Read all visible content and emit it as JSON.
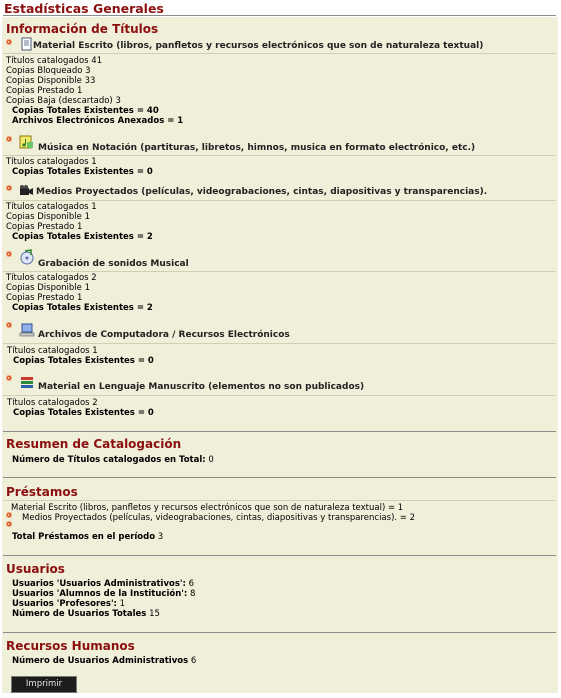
{
  "page_title": "Estadísticas Generales",
  "info_titulos": {
    "heading": "Información de Títulos",
    "categories": [
      {
        "title": "Material Escrito (libros, panfletos y recursos electrónicos que son de naturaleza textual)",
        "icon": "book-document-icon",
        "lines": [
          "Títulos catalogados 41",
          "Copias Bloqueado 3",
          "Copias Disponible 33",
          "Copias Prestado 1",
          "Copias Baja (descartado) 3"
        ],
        "totals": [
          "Copias Totales Existentes = 40",
          "Archivos Electrónicos Anexados = 1"
        ]
      },
      {
        "title": "Música en Notación (partituras, libretos, himnos, musica en formato electrónico, etc.)",
        "icon": "sheet-music-icon",
        "lines": [
          "Títulos catalogados 1"
        ],
        "totals": [
          "Copias Totales Existentes = 0"
        ]
      },
      {
        "title": "Medios Proyectados (películas, videograbaciones, cintas, diapositivas y transparencias).",
        "icon": "video-camera-icon",
        "lines": [
          "Títulos catalogados 1",
          "Copias Disponible 1",
          "Copias Prestado 1"
        ],
        "totals": [
          "Copias Totales Existentes = 2"
        ]
      },
      {
        "title": "Grabación de sonidos Musical",
        "icon": "music-recording-icon",
        "lines": [
          "Títulos catalogados 2",
          "Copias Disponible 1",
          "Copias Prestado 1"
        ],
        "totals": [
          "Copias Totales Existentes = 2"
        ]
      },
      {
        "title": "Archivos de Computadora / Recursos Electrónicos",
        "icon": "computer-icon",
        "lines": [
          "Títulos catalogados 1"
        ],
        "totals": [
          "Copias Totales Existentes = 0"
        ]
      },
      {
        "title": "Material en Lenguaje Manuscrito (elementos no son publicados)",
        "icon": "manuscript-books-icon",
        "lines": [
          "Títulos catalogados 2"
        ],
        "totals": [
          "Copias Totales Existentes = 0"
        ]
      }
    ]
  },
  "resumen": {
    "heading": "Resumen de Catalogación",
    "label": "Número de Títulos catalogados en Total:",
    "value": "0"
  },
  "prestamos": {
    "heading": "Préstamos",
    "items": [
      "Material Escrito (libros, panfletos y recursos electrónicos que son de naturaleza textual) = 1",
      "Medios Proyectados (películas, videograbaciones, cintas, diapositivas y transparencias). = 2"
    ],
    "total_label": "Total Préstamos en el período",
    "total_value": "3"
  },
  "usuarios": {
    "heading": "Usuarios",
    "rows": [
      {
        "label": "Usuarios 'Usuarios Administrativos':",
        "value": "6"
      },
      {
        "label": "Usuarios 'Alumnos de la Institución':",
        "value": "8"
      },
      {
        "label": "Usuarios 'Profesores':",
        "value": "1"
      },
      {
        "label": "Número de Usuarios Totales",
        "value": "15"
      }
    ]
  },
  "recursos": {
    "heading": "Recursos Humanos",
    "label": "Número de Usuarios Administrativos",
    "value": "6"
  },
  "print_button": "Imprimir",
  "colors": {
    "heading": "#8b0f0f",
    "panel": "#f0efd9",
    "bullet": "#d94d12",
    "button": "#1c1c1c"
  }
}
